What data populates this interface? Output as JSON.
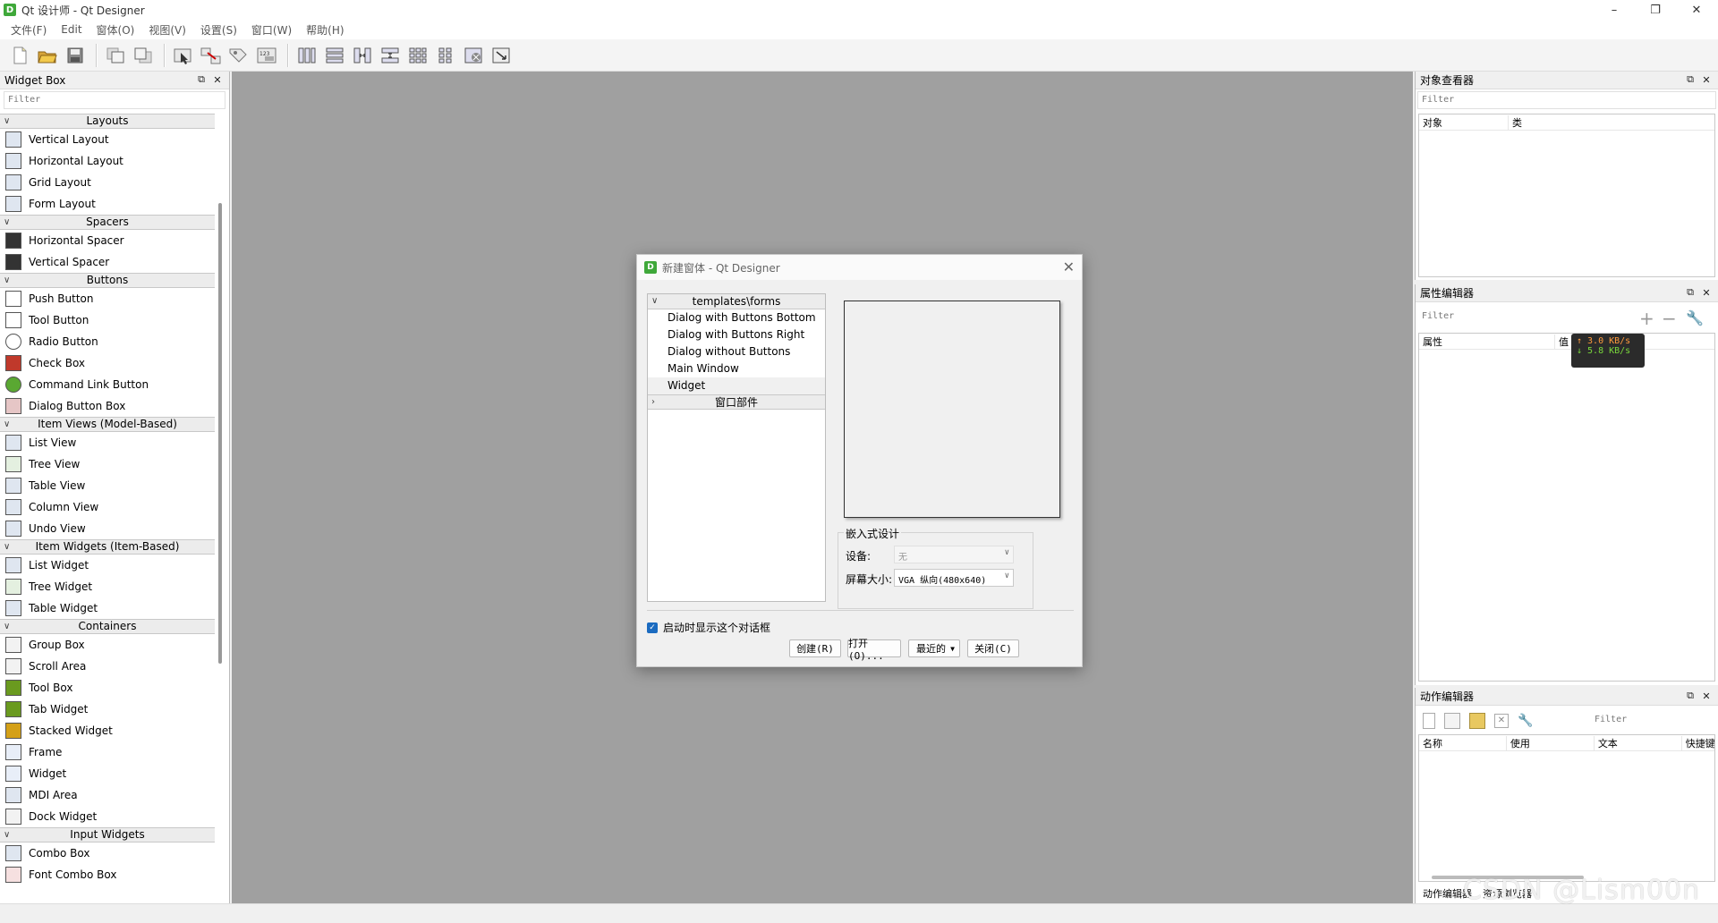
{
  "window": {
    "title": "Qt 设计师 - Qt Designer",
    "app_icon_letter": "D",
    "controls": [
      "–",
      "❐",
      "✕"
    ]
  },
  "menubar": [
    "文件(F)",
    "Edit",
    "窗体(O)",
    "视图(V)",
    "设置(S)",
    "窗口(W)",
    "帮助(H)"
  ],
  "toolbar": {
    "icons": [
      "new-file-icon",
      "open-file-icon",
      "save-icon",
      "bring-front-icon",
      "send-back-icon",
      "edit-widgets-icon",
      "edit-signals-icon",
      "edit-buddies-icon",
      "edit-tab-order-icon",
      "layout-horizontal-icon",
      "layout-vertical-icon",
      "layout-hsplitter-icon",
      "layout-vsplitter-icon",
      "layout-grid-icon",
      "layout-form-icon",
      "break-layout-icon",
      "adjust-size-icon"
    ]
  },
  "widget_box": {
    "title": "Widget Box",
    "filter_placeholder": "Filter",
    "categories": [
      {
        "label": "Layouts",
        "items": [
          "Vertical Layout",
          "Horizontal Layout",
          "Grid Layout",
          "Form Layout"
        ]
      },
      {
        "label": "Spacers",
        "items": [
          "Horizontal Spacer",
          "Vertical Spacer"
        ]
      },
      {
        "label": "Buttons",
        "items": [
          "Push Button",
          "Tool Button",
          "Radio Button",
          "Check Box",
          "Command Link Button",
          "Dialog Button Box"
        ]
      },
      {
        "label": "Item Views (Model-Based)",
        "items": [
          "List View",
          "Tree View",
          "Table View",
          "Column View",
          "Undo View"
        ]
      },
      {
        "label": "Item Widgets (Item-Based)",
        "items": [
          "List Widget",
          "Tree Widget",
          "Table Widget"
        ]
      },
      {
        "label": "Containers",
        "items": [
          "Group Box",
          "Scroll Area",
          "Tool Box",
          "Tab Widget",
          "Stacked Widget",
          "Frame",
          "Widget",
          "MDI Area",
          "Dock Widget"
        ]
      },
      {
        "label": "Input Widgets",
        "items": [
          "Combo Box",
          "Font Combo Box"
        ]
      }
    ]
  },
  "object_inspector": {
    "title": "对象查看器",
    "filter_placeholder": "Filter",
    "col_object": "对象",
    "col_class": "类"
  },
  "property_editor": {
    "title": "属性编辑器",
    "filter_placeholder": "Filter",
    "col_property": "属性",
    "col_value": "值"
  },
  "network_badge": {
    "up": "↑ 3.0 KB/s",
    "down": "↓ 5.8 KB/s"
  },
  "action_editor": {
    "title": "动作编辑器",
    "filter_placeholder": "Filter",
    "columns": [
      "名称",
      "使用",
      "文本",
      "快捷键"
    ],
    "tabs": [
      "动作编辑器",
      "资源浏览器"
    ]
  },
  "new_form_dialog": {
    "title": "新建窗体 - Qt Designer",
    "template_category": "templates\\forms",
    "templates": [
      "Dialog with Buttons Bottom",
      "Dialog with Buttons Right",
      "Dialog without Buttons",
      "Main Window",
      "Widget"
    ],
    "selected_template": "Widget",
    "widgets_category": "窗口部件",
    "embedded_design": {
      "legend": "嵌入式设计",
      "device_label": "设备:",
      "device_value": "无",
      "screen_size_label": "屏幕大小:",
      "screen_size_value": "VGA 纵向(480x640)"
    },
    "show_on_startup_label": "启动时显示这个对话框",
    "show_on_startup_checked": true,
    "buttons": {
      "create": "创建(R)",
      "open": "打开(O)...",
      "recent": "最近的",
      "close": "关闭(C)"
    }
  },
  "watermark": "CSDN @Lism00n",
  "colors": {
    "mdi_background": "#a0a0a0",
    "qt_green": "#3fa83a",
    "checkbox_blue": "#1b6bc0"
  }
}
